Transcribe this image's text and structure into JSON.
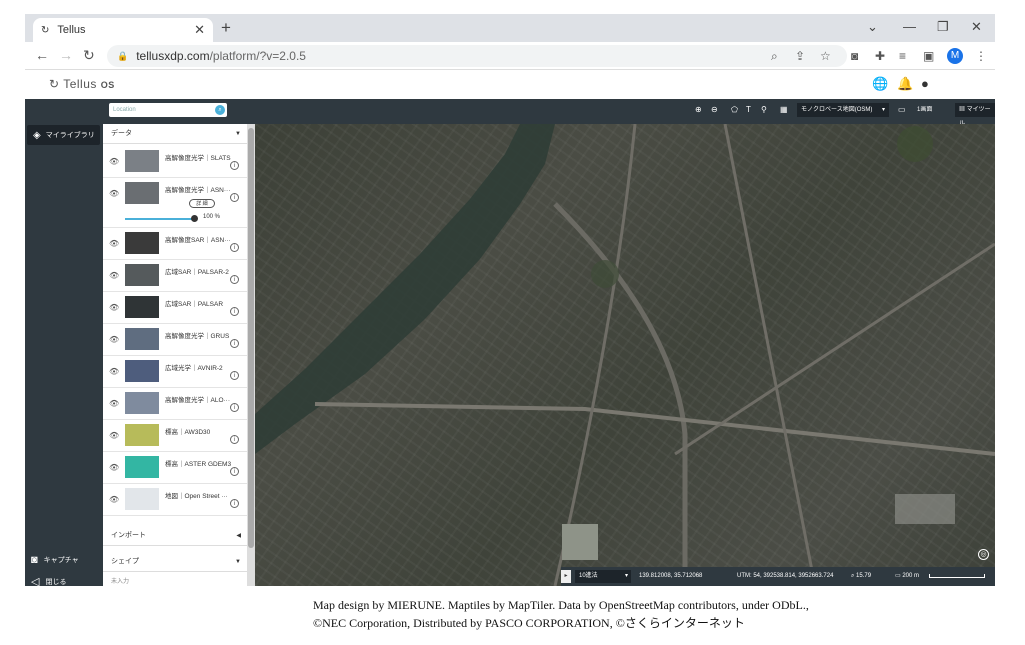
{
  "browser": {
    "tab_title": "Tellus",
    "url_domain": "tellusxdp.com",
    "url_path": "/platform/?v=2.0.5",
    "avatar": "M",
    "accent": "#1a73e8"
  },
  "app": {
    "logo": "Tellus",
    "logo_suffix": "OS"
  },
  "toolbar": {
    "search_placeholder": "Location",
    "basemap": "モノクロベース地図(OSM)",
    "screen": "1画面",
    "mytools": "マイツール"
  },
  "leftnav": {
    "library": "マイライブラリ",
    "capture": "キャプチャ",
    "close": "閉じる"
  },
  "panel": {
    "data_header": "データ",
    "detail_button": "詳 細",
    "opacity": "100 %",
    "layers": [
      {
        "name": "高解像度光学｜SLATS",
        "thumb": "#7b8086"
      },
      {
        "name": "高解像度光学｜ASN···",
        "thumb": "#6a6e72"
      },
      {
        "name": "高解像度SAR｜ASN···",
        "thumb": "#3a3a3a"
      },
      {
        "name": "広域SAR｜PALSAR-2",
        "thumb": "#555a5c"
      },
      {
        "name": "広域SAR｜PALSAR",
        "thumb": "#2f3436"
      },
      {
        "name": "高解像度光学｜GRUS",
        "thumb": "#5f6d80"
      },
      {
        "name": "広域光学｜AVNIR-2",
        "thumb": "#4e5d7d"
      },
      {
        "name": "高解像度光学｜ALO···",
        "thumb": "#7f8b9e"
      },
      {
        "name": "標高｜AW3D30",
        "thumb": "#b7bb5a"
      },
      {
        "name": "標高｜ASTER GDEM3",
        "thumb": "#33b6a3"
      },
      {
        "name": "地図｜Open Street ···",
        "thumb": "#e2e6ea"
      }
    ],
    "import_header": "インポート",
    "shape_header": "シェイプ",
    "bottom_text": "未入力"
  },
  "statusbar": {
    "scale": "10進法",
    "coords": "139.812008, 35.712068",
    "utm": "UTM: 54, 392538.814, 3952663.724",
    "zoom": "15.79",
    "distance": "200 m"
  },
  "attribution": {
    "line1": "Map design by MIERUNE. Maptiles by MapTiler. Data by OpenStreetMap contributors, under ODbL.,",
    "line2": "©NEC Corporation, Distributed by PASCO CORPORATION, ©さくらインターネット"
  }
}
